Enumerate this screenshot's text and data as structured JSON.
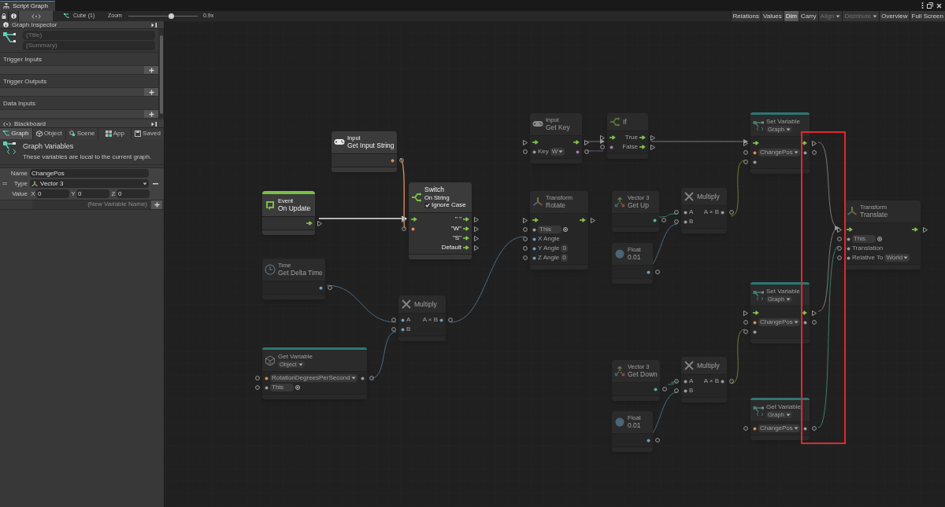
{
  "window": {
    "tab": "Script Graph"
  },
  "toolbar": {
    "object": "Cube (1)",
    "zoom_label": "Zoom",
    "zoom": {
      "level": 0.62
    },
    "zoom_reading": "0.9x",
    "buttons": [
      {
        "label": "Relations",
        "selected": false,
        "disabled": false
      },
      {
        "label": "Values",
        "selected": false,
        "disabled": false
      },
      {
        "label": "Dim",
        "selected": true,
        "disabled": false
      },
      {
        "label": "Carry",
        "selected": false,
        "disabled": false
      },
      {
        "label": "Align",
        "selected": false,
        "disabled": true,
        "dropdown": true
      },
      {
        "label": "Distribute",
        "selected": false,
        "disabled": true,
        "dropdown": true
      },
      {
        "label": "Overview",
        "selected": false,
        "disabled": false
      },
      {
        "label": "Full Screen",
        "selected": false,
        "disabled": false
      }
    ]
  },
  "inspector": {
    "title": "Graph Inspector",
    "title_placeholder": "(Title)",
    "summary_placeholder": "(Summary)",
    "sections": [
      "Trigger Inputs",
      "Trigger Outputs",
      "Data Inputs"
    ]
  },
  "blackboard": {
    "title": "Blackboard",
    "tabs": [
      {
        "label": "Graph",
        "selected": true
      },
      {
        "label": "Object",
        "selected": false
      },
      {
        "label": "Scene",
        "selected": false
      },
      {
        "label": "App",
        "selected": false
      },
      {
        "label": "Saved",
        "selected": false
      }
    ],
    "heading": "Graph Variables",
    "description": "These variables are local to the current graph.",
    "name_label": "Name",
    "type_label": "Type",
    "value_label": "Value",
    "variables": [
      {
        "name": "ChangePos",
        "type": "Vector 3",
        "axes": [
          {
            "label": "X",
            "value": "0"
          },
          {
            "label": "Y",
            "value": "0"
          },
          {
            "label": "Z",
            "value": "0"
          }
        ]
      }
    ],
    "new_variable_placeholder": "(New Variable Name)"
  },
  "graph": {
    "nodes": [
      {
        "kind": "unit",
        "category": "Input",
        "title": "Get Input String",
        "dimmed": false,
        "rows": [
          {
            "data_out": true,
            "color": "#e0894f"
          }
        ]
      },
      {
        "kind": "event",
        "category": "Event",
        "title": "On Update",
        "dimmed": false,
        "rows": [
          {
            "flow_out": true
          }
        ]
      },
      {
        "kind": "unit",
        "title": "Switch",
        "subtitle": "On String",
        "option": {
          "label": "Ignore Case",
          "checked": true
        },
        "dimmed": false,
        "rows": [
          {
            "flow_in": true,
            "out_label": "\" \"",
            "flow_out": true
          },
          {
            "data_in": true,
            "color": "#e0894f",
            "out_label": "\"W\"",
            "flow_out": true
          },
          {
            "out_label": "\"S\"",
            "flow_out": true
          },
          {
            "out_label": "Default",
            "flow_out": true
          }
        ]
      },
      {
        "kind": "unit",
        "category": "Time",
        "title": "Get Delta Time",
        "dimmed": true,
        "rows": [
          {
            "data_out": true,
            "color": "#6a9fc0"
          }
        ]
      },
      {
        "kind": "unit",
        "title": "Multiply",
        "dimmed": true,
        "rows": [
          {
            "data_in": true,
            "color": "#6a9fc0",
            "label": "A",
            "out_label": "A × B",
            "data_out": true,
            "output_port": {
              "color": "#6a9fc0"
            }
          },
          {
            "data_in": true,
            "color": "#6a9fc0",
            "label": "B"
          }
        ]
      },
      {
        "kind": "variable",
        "category": "Get Variable",
        "scope": "Object",
        "dimmed": true,
        "rows": [
          {
            "data_in": true,
            "color": "#e0894f",
            "field": "RotationDegreesPerSecond",
            "dropdown": true,
            "data_out": true
          },
          {
            "data_in": true,
            "field": "This",
            "picker": true
          }
        ]
      },
      {
        "kind": "unit",
        "category": "Input",
        "title": "Get Key",
        "dimmed": true,
        "rows": [
          {
            "flow_in": true,
            "flow_out": true
          },
          {
            "data_in": true,
            "label": "Key",
            "field": "W",
            "dropdown": true,
            "data_out": true,
            "output_port": {
              "color": "#a07ab5"
            }
          }
        ]
      },
      {
        "kind": "unit",
        "title": "If",
        "dimmed": true,
        "rows": [
          {
            "flow_in": true,
            "out_label": "True",
            "flow_out": true
          },
          {
            "data_in": true,
            "color": "#a07ab5",
            "out_label": "False",
            "flow_out": true
          }
        ]
      },
      {
        "kind": "unit",
        "category": "Transform",
        "title": "Rotate",
        "dimmed": true,
        "rows": [
          {
            "flow_in": true,
            "flow_out": true
          },
          {
            "data_in": true,
            "field": "This",
            "picker": true
          },
          {
            "data_in": true,
            "color": "#6a9fc0",
            "label": "X Angle"
          },
          {
            "data_in": true,
            "color": "#6a9fc0",
            "label": "Y Angle",
            "field": "0"
          },
          {
            "data_in": true,
            "color": "#6a9fc0",
            "label": "Z Angle",
            "field": "0"
          }
        ]
      },
      {
        "kind": "unit",
        "category": "Vector 3",
        "title": "Get Up",
        "dimmed": true,
        "rows": [
          {
            "data_out": true,
            "color": "#4fb09a"
          }
        ]
      },
      {
        "kind": "unit",
        "category": "Float",
        "title": "0.01",
        "dimmed": true,
        "rows": [
          {
            "data_out": true,
            "color": "#6a9fc0"
          }
        ]
      },
      {
        "kind": "unit",
        "title": "Multiply",
        "dimmed": true,
        "rows": [
          {
            "data_in": true,
            "label": "A",
            "out_label": "A × B",
            "data_out": true
          },
          {
            "data_in": true,
            "label": "B"
          }
        ]
      },
      {
        "kind": "variable",
        "category": "Set Variable",
        "scope": "Graph",
        "dimmed": true,
        "rows": [
          {
            "flow_in": true,
            "flow_out": true
          },
          {
            "data_in": true,
            "color": "#e0894f",
            "field": "ChangePos",
            "dropdown": true,
            "data_out": true
          },
          {
            "data_in": true
          }
        ]
      },
      {
        "kind": "unit",
        "category": "Transform",
        "title": "Translate",
        "dimmed": true,
        "rows": [
          {
            "flow_in": true,
            "flow_out": true
          },
          {
            "data_in": true,
            "field": "This",
            "picker": true
          },
          {
            "data_in": true,
            "label": "Translation"
          },
          {
            "data_in": true,
            "label": "Relative To",
            "field": "World",
            "dropdown": true
          }
        ]
      },
      {
        "kind": "variable",
        "category": "Set Variable",
        "scope": "Graph",
        "dimmed": true,
        "rows": [
          {
            "flow_in": true,
            "flow_out": true
          },
          {
            "data_in": true,
            "color": "#e0894f",
            "field": "ChangePos",
            "dropdown": true,
            "data_out": true
          },
          {
            "data_in": true
          }
        ]
      },
      {
        "kind": "unit",
        "category": "Vector 3",
        "title": "Get Down",
        "dimmed": true,
        "rows": [
          {
            "data_out": true,
            "color": "#4fb09a"
          }
        ]
      },
      {
        "kind": "unit",
        "title": "Multiply",
        "dimmed": true,
        "rows": [
          {
            "data_in": true,
            "label": "A",
            "out_label": "A × B",
            "data_out": true
          },
          {
            "data_in": true,
            "label": "B"
          }
        ]
      },
      {
        "kind": "unit",
        "category": "Float",
        "title": "0.01",
        "dimmed": true,
        "rows": [
          {
            "data_out": true,
            "color": "#6a9fc0"
          }
        ]
      },
      {
        "kind": "variable",
        "category": "Get Variable",
        "scope": "Graph",
        "dimmed": true,
        "rows": [
          {
            "data_in": true,
            "color": "#e0894f",
            "field": "ChangePos",
            "dropdown": true,
            "data_out": true
          }
        ]
      }
    ],
    "highlight": true
  }
}
